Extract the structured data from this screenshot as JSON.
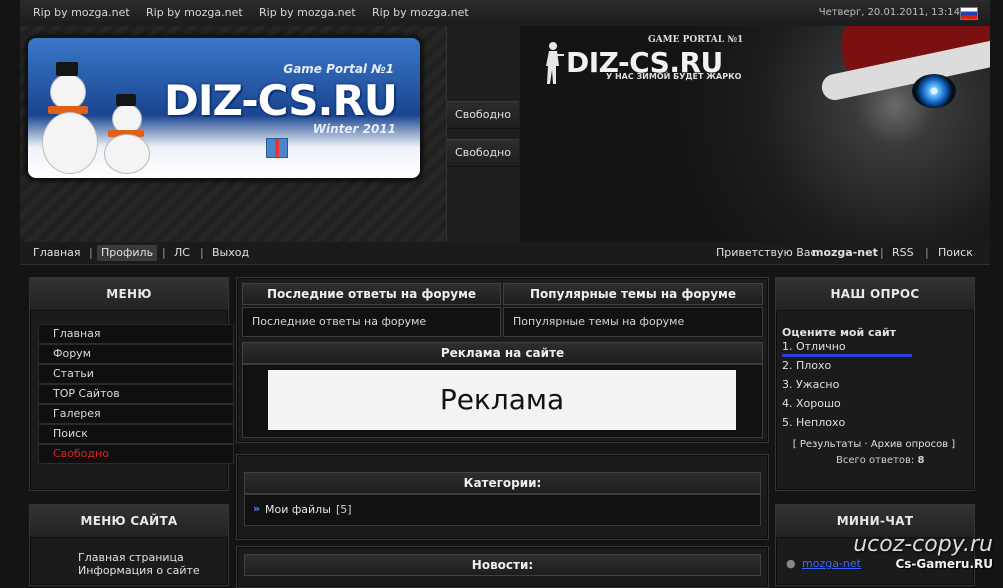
{
  "topbar": {
    "rip_links": [
      "Rip by mozga.net",
      "Rip by mozga.net",
      "Rip by mozga.net",
      "Rip by mozga.net"
    ],
    "datetime": "Четверг, 20.01.2011, 13:14"
  },
  "header": {
    "banner": {
      "portal": "Game Portal №1",
      "title": "DIZ-CS.RU",
      "subtitle": "Winter 2011"
    },
    "slots": [
      "Свободно",
      "Свободно"
    ],
    "logo": {
      "portal": "GAME PORTAL №1",
      "title": "DIZ-CS.RU",
      "slogan": "У НАС ЗИМОЙ БУДЕТ ЖАРКО"
    }
  },
  "nav": {
    "left": [
      "Главная",
      "Профиль",
      "ЛС",
      "Выход"
    ],
    "greeting": "Приветствую Вас",
    "username": "mozga-net",
    "right": [
      "RSS",
      "Поиск"
    ]
  },
  "left_menu": {
    "title": "МЕНЮ",
    "items": [
      "Главная",
      "Форум",
      "Статьи",
      "ТОР Сайтов",
      "Галерея",
      "Поиск",
      "Свободно"
    ]
  },
  "site_menu": {
    "title": "МЕНЮ САЙТА",
    "items": [
      "Главная страница",
      "Информация о сайте"
    ]
  },
  "center": {
    "forum_latest_title": "Последние ответы на форуме",
    "forum_popular_title": "Популярные темы на форуме",
    "forum_latest_body": "Последние ответы на форуме",
    "forum_popular_body": "Популярные темы на форуме",
    "ads_title": "Реклама на сайте",
    "ad_text": "Реклама",
    "categories_title": "Категории:",
    "category_item": "Мои файлы",
    "category_count": "[5]",
    "news_title": "Новости:"
  },
  "poll": {
    "title": "НАШ ОПРОС",
    "question": "Оцените мой сайт",
    "options": [
      "1. Отлично",
      "2. Плохо",
      "3. Ужасно",
      "4. Хорошо",
      "5. Неплохо"
    ],
    "links": "[ Результаты · Архив опросов ]",
    "total_label": "Всего ответов:",
    "total": "8"
  },
  "chat": {
    "title": "МИНИ-ЧАТ",
    "user": "mozga-net"
  },
  "watermarks": {
    "ucoz": "ucoz-copy.ru",
    "gameru": "Cs-Gameru.RU"
  },
  "colors": {
    "accent_red": "#e02020",
    "poll_bar": "#2a3fd6",
    "link_blue": "#3a66ff"
  }
}
